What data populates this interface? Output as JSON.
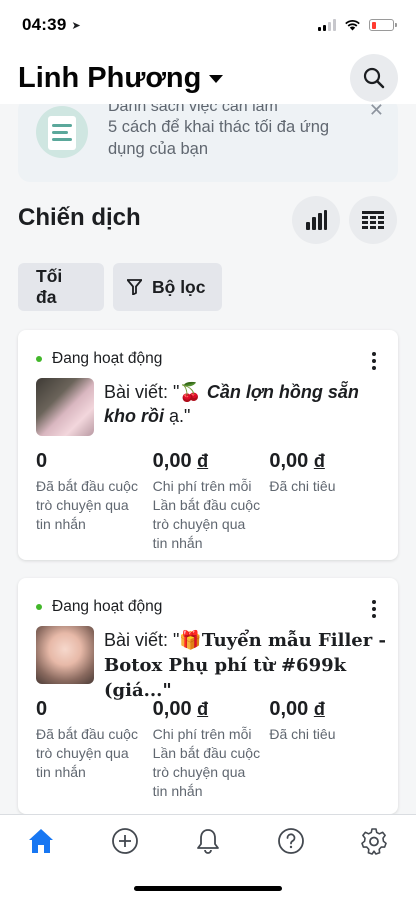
{
  "status_bar": {
    "time": "04:39",
    "battery_color": "#ff3b30"
  },
  "header": {
    "account_name": "Linh Phương"
  },
  "tip": {
    "title": "Danh sách việc cần làm",
    "description": "5 cách để khai thác tối đa ứng dụng của bạn"
  },
  "campaigns_section": {
    "title": "Chiến dịch",
    "max_label": "Tối đa",
    "filter_label": "Bộ lọc"
  },
  "campaigns": [
    {
      "status": "Đang hoạt động",
      "title_prefix": "Bài viết: \"",
      "emoji": "🍒",
      "title_name": " Cần lợn hồng sẵn kho rồi",
      "title_suffix": " ạ.\"",
      "metrics": [
        {
          "value": "0",
          "currency": "",
          "label": "Đã bắt đầu cuộc trò chuyện qua tin nhắn"
        },
        {
          "value": "0,00 ",
          "currency": "đ",
          "label": "Chi phí trên mỗi Lần bắt đầu cuộc trò chuyện qua tin nhắn"
        },
        {
          "value": "0,00 ",
          "currency": "đ",
          "label": "Đã chi tiêu"
        }
      ]
    },
    {
      "status": "Đang hoạt động",
      "title_prefix": "Bài viết: \"",
      "emoji": "🎁",
      "title_name": "Tuyển mẫu Filler - Botox Phụ phí từ #699k  (giá...\"",
      "title_suffix": "",
      "metrics": [
        {
          "value": "0",
          "currency": "",
          "label": "Đã bắt đầu cuộc trò chuyện qua tin nhắn"
        },
        {
          "value": "0,00 ",
          "currency": "đ",
          "label": "Chi phí trên mỗi Lần bắt đầu cuộc trò chuyện qua tin nhắn"
        },
        {
          "value": "0,00 ",
          "currency": "đ",
          "label": "Đã chi tiêu"
        }
      ]
    }
  ],
  "tab_bar": {
    "active_color": "#1877f2",
    "icons": [
      "home-icon",
      "plus-icon",
      "bell-icon",
      "help-icon",
      "settings-icon"
    ]
  }
}
